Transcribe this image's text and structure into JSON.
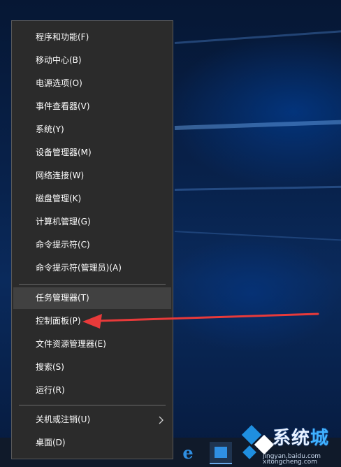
{
  "menu": {
    "items": [
      {
        "label": "程序和功能(F)"
      },
      {
        "label": "移动中心(B)"
      },
      {
        "label": "电源选项(O)"
      },
      {
        "label": "事件查看器(V)"
      },
      {
        "label": "系统(Y)"
      },
      {
        "label": "设备管理器(M)"
      },
      {
        "label": "网络连接(W)"
      },
      {
        "label": "磁盘管理(K)"
      },
      {
        "label": "计算机管理(G)"
      },
      {
        "label": "命令提示符(C)"
      },
      {
        "label": "命令提示符(管理员)(A)"
      },
      {
        "label": "任务管理器(T)",
        "highlighted": true
      },
      {
        "label": "控制面板(P)"
      },
      {
        "label": "文件资源管理器(E)"
      },
      {
        "label": "搜索(S)"
      },
      {
        "label": "运行(R)"
      },
      {
        "label": "关机或注销(U)",
        "has_submenu": true
      },
      {
        "label": "桌面(D)"
      }
    ]
  },
  "annotation": {
    "arrow_color": "#e83a3a",
    "target": "控制面板(P)"
  },
  "taskbar": {
    "edge_glyph": "e",
    "store_glyph": "▣"
  },
  "watermark": {
    "title_part1": "系统",
    "title_part2": "城",
    "line1": "jingyan.baidu.com",
    "line2": "xitongcheng.com"
  },
  "colors": {
    "menu_bg": "#2b2b2b",
    "highlight_bg": "#414141",
    "desktop_blue": "#0a2a5c"
  }
}
